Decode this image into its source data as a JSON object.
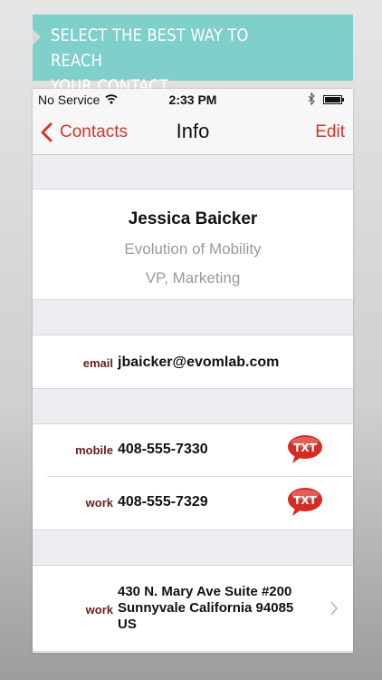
{
  "banner": {
    "text": "SELECT THE BEST WAY TO REACH\nYOUR CONTACT",
    "color": "#7fcfcb"
  },
  "status": {
    "carrier": "No Service",
    "time": "2:33 PM"
  },
  "nav": {
    "back_label": "Contacts",
    "title": "Info",
    "edit_label": "Edit",
    "accent": "#d5342c"
  },
  "contact": {
    "name": "Jessica Baicker",
    "company": "Evolution of Mobility",
    "job_title": "VP, Marketing"
  },
  "email": {
    "label": "email",
    "value": "jbaicker@evomlab.com"
  },
  "phones": [
    {
      "label": "mobile",
      "value": "408-555-7330",
      "action": "TXT"
    },
    {
      "label": "work",
      "value": "408-555-7329",
      "action": "TXT"
    }
  ],
  "address": {
    "label": "work",
    "value": "430 N. Mary Ave Suite #200\nSunnyvale California 94085\nUS"
  },
  "icons": [
    "wifi-icon",
    "bluetooth-icon",
    "battery-icon",
    "back-chevron-icon",
    "txt-bubble-icon",
    "disclosure-chevron-icon"
  ]
}
